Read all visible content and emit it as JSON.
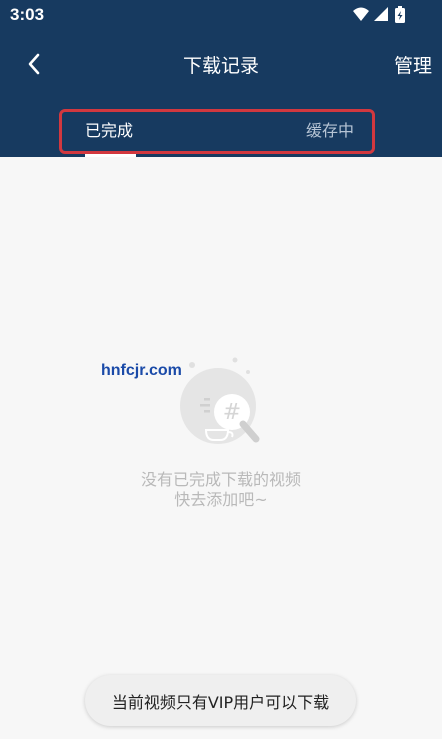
{
  "status_bar": {
    "time": "3:03",
    "icons": [
      "wifi-icon",
      "signal-icon",
      "battery-charging-icon"
    ]
  },
  "app_bar": {
    "back_icon": "chevron-left-icon",
    "title": "下载记录",
    "manage_label": "管理"
  },
  "tabs": [
    {
      "label": "已完成",
      "selected": true
    },
    {
      "label": "缓存中",
      "selected": false
    }
  ],
  "watermark": "hnfcjr.com",
  "empty_state": {
    "illustration_icon": "empty-hashtag-cup-icon",
    "line1": "没有已完成下载的视频",
    "line2": "快去添加吧~"
  },
  "toast": "当前视频只有VIP用户可以下载",
  "colors": {
    "header_bg": "#173a60",
    "highlight_border": "#d2383f",
    "page_bg": "#f7f7f7",
    "empty_text": "#b9b9b9",
    "watermark": "#1a4aa8"
  }
}
